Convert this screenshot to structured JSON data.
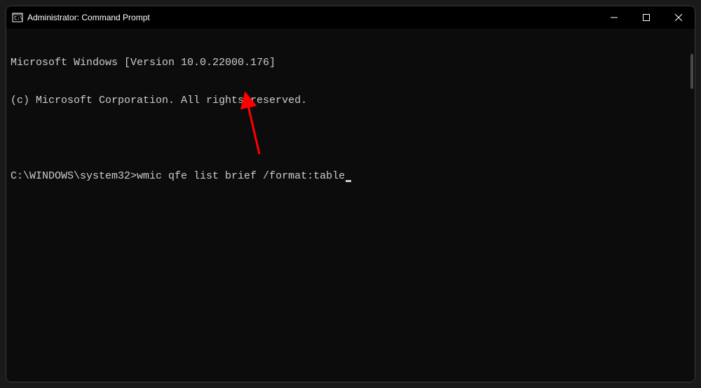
{
  "titlebar": {
    "title": "Administrator: Command Prompt"
  },
  "terminal": {
    "line1": "Microsoft Windows [Version 10.0.22000.176]",
    "line2": "(c) Microsoft Corporation. All rights reserved.",
    "prompt": "C:\\WINDOWS\\system32>",
    "command": "wmic qfe list brief /format:table"
  },
  "annotation": {
    "arrow_color": "#ff0000"
  }
}
